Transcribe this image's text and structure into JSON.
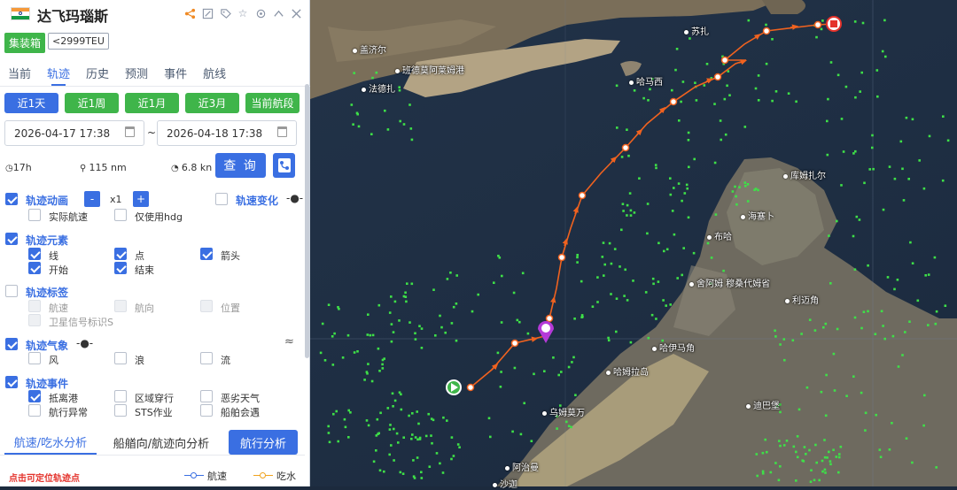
{
  "vessel": {
    "name": "达飞玛瑙斯",
    "type_tag": "集装箱",
    "size_tag": "<2999TEU",
    "flag_colors": [
      "#f5993a",
      "#ffffff",
      "#139a43"
    ]
  },
  "header_icons": [
    "share-icon",
    "edit-icon",
    "tag-icon",
    "star-icon",
    "locate-icon",
    "collapse-icon",
    "close-icon"
  ],
  "tabs": [
    {
      "label": "当前",
      "active": false
    },
    {
      "label": "轨迹",
      "active": true
    },
    {
      "label": "历史",
      "active": false
    },
    {
      "label": "预测",
      "active": false
    },
    {
      "label": "事件",
      "active": false
    },
    {
      "label": "航线",
      "active": false
    }
  ],
  "range_buttons": [
    {
      "label": "近1天",
      "active": true
    },
    {
      "label": "近1周",
      "active": false
    },
    {
      "label": "近1月",
      "active": false
    },
    {
      "label": "近3月",
      "active": false
    },
    {
      "label": "当前航段",
      "active": false
    }
  ],
  "date_from": "2026-04-17 17:38",
  "date_separator": "~",
  "date_to": "2026-04-18 17:38",
  "stats": {
    "duration": "17h",
    "distance": "115 nm",
    "speed": "6.8 kn"
  },
  "query_label": "查 询",
  "track_animation": {
    "label": "轨迹动画",
    "minus": "-",
    "speed": "x1",
    "plus": "+",
    "options": [
      "实际航速",
      "仅使用hdg"
    ]
  },
  "speed_change_label": "轨速变化",
  "track_elements": {
    "label": "轨迹元素",
    "options": [
      "线",
      "点",
      "箭头",
      "开始",
      "结束"
    ]
  },
  "track_labels": {
    "label": "轨迹标签",
    "options": [
      "航速",
      "航向",
      "位置",
      "卫星信号标识S"
    ]
  },
  "track_weather": {
    "label": "轨迹气象",
    "options": [
      "风",
      "浪",
      "流"
    ]
  },
  "track_events": {
    "label": "轨迹事件",
    "options": [
      "抵离港",
      "区域穿行",
      "恶劣天气",
      "航行异常",
      "STS作业",
      "船舶会遇"
    ]
  },
  "bottom_tabs": [
    "航速/吃水分析",
    "船艏向/航迹向分析",
    "航行分析"
  ],
  "footer": {
    "hint": "点击可定位轨迹点",
    "legend_speed": "航速",
    "legend_draft": "吃水"
  },
  "map_places": [
    {
      "name": "盖济尔"
    },
    {
      "name": "班德莫阿莱姆港"
    },
    {
      "name": "法德扎"
    },
    {
      "name": "苏扎"
    },
    {
      "name": "哈马西"
    },
    {
      "name": "库姆扎尔"
    },
    {
      "name": "海塞卜"
    },
    {
      "name": "布哈"
    },
    {
      "name": "舍阿姆 穆桑代姆省"
    },
    {
      "name": "利迈角"
    },
    {
      "name": "哈伊马角"
    },
    {
      "name": "哈姆拉岛"
    },
    {
      "name": "乌姆莫万"
    },
    {
      "name": "迪巴堡"
    },
    {
      "name": "阿治曼"
    },
    {
      "name": "沙迦"
    }
  ],
  "colors": {
    "accent": "#3a6fe2",
    "green": "#3fb54a",
    "track": "#f0621f"
  }
}
